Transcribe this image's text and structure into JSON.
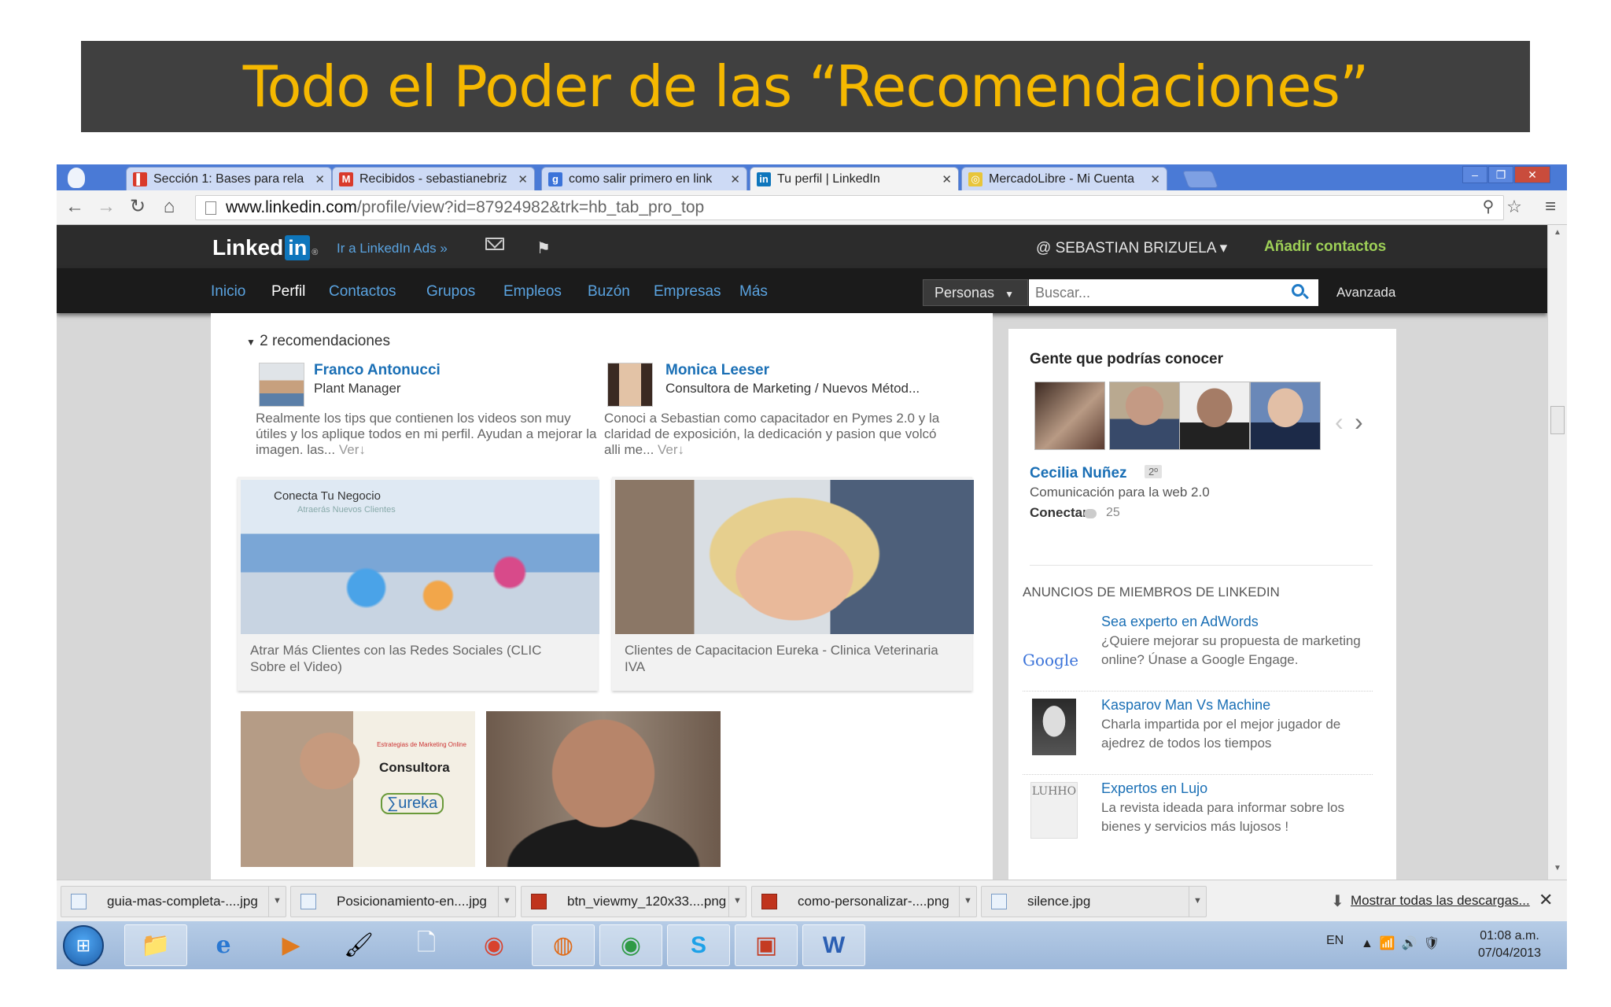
{
  "slide": {
    "title": "Todo el Poder de las “Recomendaciones”"
  },
  "browser": {
    "tabs": [
      {
        "label": "Sección 1: Bases para rela",
        "icon": "udemy-icon",
        "color": "#d93a2b",
        "glyph": "▌"
      },
      {
        "label": "Recibidos - sebastianebriz",
        "icon": "gmail-icon",
        "color": "#d93a2b",
        "glyph": "M"
      },
      {
        "label": "como salir primero en link",
        "icon": "google-icon",
        "color": "#3b73d9",
        "glyph": "g"
      },
      {
        "label": "Tu perfil | LinkedIn",
        "icon": "linkedin-icon",
        "color": "#0e76bc",
        "glyph": "in"
      },
      {
        "label": "MercadoLibre - Mi Cuenta",
        "icon": "mercadolibre-icon",
        "color": "#e8c53a",
        "glyph": "◎"
      }
    ],
    "url_domain": "www.linkedin.com",
    "url_path": "/profile/view?id=87924982&trk=hb_tab_pro_top"
  },
  "linkedin": {
    "logo_text": "Linked",
    "logo_in": "in",
    "ads_link": "Ir a LinkedIn Ads »",
    "user": "@ SEBASTIAN BRIZUELA ▾",
    "add_contacts": "Añadir contactos",
    "nav": [
      "Inicio",
      "Perfil",
      "Contactos",
      "Grupos",
      "Empleos",
      "Buzón",
      "Empresas",
      "Más"
    ],
    "search_scope": "Personas",
    "search_placeholder": "Buscar...",
    "advanced": "Avanzada"
  },
  "recommendations": {
    "header": "2 recomendaciones",
    "items": [
      {
        "name": "Franco Antonucci",
        "role": "Plant Manager",
        "text": "Realmente los tips que contienen los videos son muy útiles y los aplique todos en mi perfil. Ayudan a mejorar la imagen. las...",
        "more": "Ver↓"
      },
      {
        "name": "Monica Leeser",
        "role": "Consultora de Marketing / Nuevos Métod...",
        "text": "Conoci a Sebastian como capacitador en Pymes 2.0 y la claridad de exposición, la dedicación y pasion que volcó alli me...",
        "more": "Ver↓"
      }
    ]
  },
  "media": [
    {
      "caption": "Atrar Más Clientes con las Redes Sociales (CLIC Sobre el Video)",
      "img_title": "Conecta Tu Negocio",
      "img_sub": "Atraerás Nuevos Clientes"
    },
    {
      "caption": "Clientes de Capacitacion Eureka - Clinica Veterinaria IVA"
    },
    {
      "img_text": "Consultora",
      "img_logo": "∑ureka",
      "img_band": "Estrategias de Marketing Online"
    },
    {}
  ],
  "sidebar": {
    "title": "Gente que podrías conocer",
    "person": {
      "name": "Cecilia Nuñez",
      "degree": "2º",
      "job": "Comunicación para la web 2.0",
      "connect": "Conectar",
      "count": "25"
    },
    "ads_title": "ANUNCIOS DE MIEMBROS DE LINKEDIN",
    "ads": [
      {
        "logo": "Google",
        "title": "Sea experto en AdWords",
        "body": "¿Quiere mejorar su propuesta de marketing online? Únase a Google Engage."
      },
      {
        "logo": "",
        "title": "Kasparov Man Vs Machine",
        "body": "Charla impartida por el mejor jugador de ajedrez de todos los tiempos"
      },
      {
        "logo": "LUHHO",
        "title": "Expertos en Lujo",
        "body": "La revista ideada para informar sobre los bienes y servicios más lujosos !"
      }
    ]
  },
  "downloads": {
    "files": [
      "guia-mas-completa-....jpg",
      "Posicionamiento-en....jpg",
      "btn_viewmy_120x33....png",
      "como-personalizar-....png",
      "silence.jpg"
    ],
    "show_all": "Mostrar todas las descargas..."
  },
  "taskbar": {
    "lang": "EN",
    "time": "01:08 a.m.",
    "date": "07/04/2013"
  },
  "colors": {
    "accent": "#0e76bc",
    "title": "#f5b800",
    "add": "#9ed057"
  }
}
